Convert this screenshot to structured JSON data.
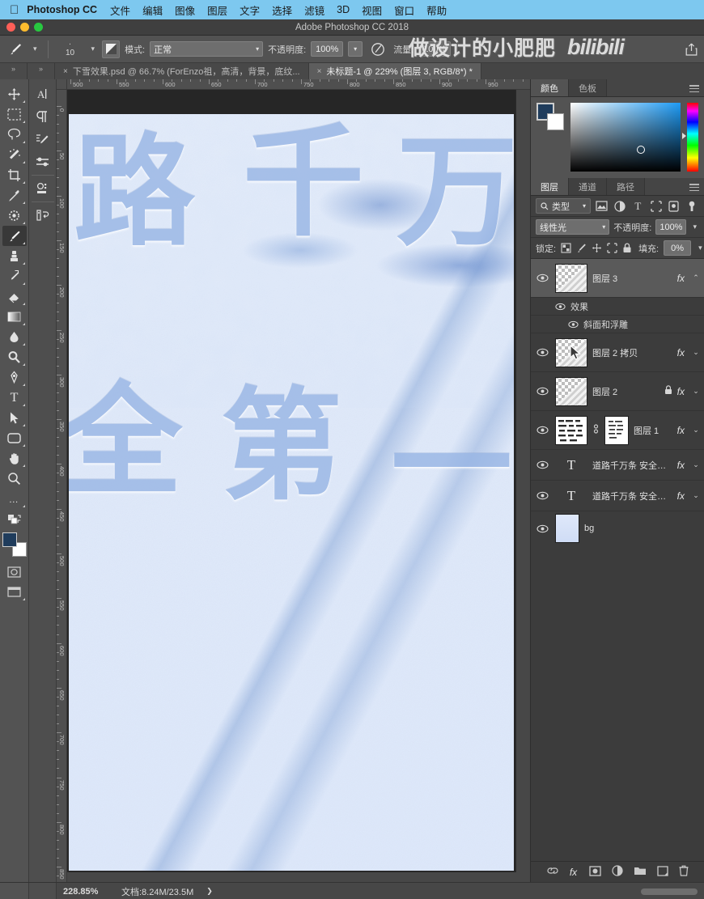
{
  "macmenu": {
    "apple_icon": "apple-icon",
    "app_name": "Photoshop CC",
    "items": [
      "文件",
      "编辑",
      "图像",
      "图层",
      "文字",
      "选择",
      "滤镜",
      "3D",
      "视图",
      "窗口",
      "帮助"
    ]
  },
  "titlebar": {
    "title": "Adobe Photoshop CC 2018"
  },
  "optionsbar": {
    "brush_preset_icon": "brush-icon",
    "brush_size": "10",
    "brush_size_dot": "·",
    "airbrush_icon": "airbrush-toggle-icon",
    "mode_label": "模式:",
    "mode_value": "正常",
    "opacity_label": "不透明度:",
    "opacity_value": "100%",
    "pressure_opacity_icon": "pressure-opacity-icon",
    "flow_label": "流量:",
    "flow_value": "100%",
    "share_icon": "share-icon",
    "watermark_cn": "做设计的小肥肥",
    "watermark_bili": "bilibili"
  },
  "tabs": [
    {
      "label": "下雪效果.psd @ 66.7% (ForEnzo祖，高清，背景，底纹...",
      "close": "×",
      "active": false
    },
    {
      "label": "未标题-1 @ 229% (图层 3, RGB/8*) *",
      "close": "×",
      "active": true
    }
  ],
  "toolbar": {
    "tools": [
      {
        "name": "move-tool",
        "glyph": "✥",
        "selected": false
      },
      {
        "name": "marquee-tool",
        "glyph": "▭",
        "selected": false
      },
      {
        "name": "lasso-tool",
        "glyph": "◯",
        "selected": false
      },
      {
        "name": "magic-wand-tool",
        "glyph": "✦",
        "selected": false
      },
      {
        "name": "crop-tool",
        "glyph": "⌗",
        "selected": false
      },
      {
        "name": "eyedropper-tool",
        "glyph": "⚲",
        "selected": false
      },
      {
        "name": "healing-brush-tool",
        "glyph": "✷",
        "selected": false
      },
      {
        "name": "brush-tool",
        "glyph": "🖌",
        "selected": true
      },
      {
        "name": "clone-stamp-tool",
        "glyph": "⬒",
        "selected": false
      },
      {
        "name": "history-brush-tool",
        "glyph": "❧",
        "selected": false
      },
      {
        "name": "eraser-tool",
        "glyph": "◣",
        "selected": false
      },
      {
        "name": "gradient-tool",
        "glyph": "▤",
        "selected": false
      },
      {
        "name": "blur-tool",
        "glyph": "💧",
        "selected": false
      },
      {
        "name": "dodge-tool",
        "glyph": "🔍",
        "selected": false
      },
      {
        "name": "pen-tool",
        "glyph": "✎",
        "selected": false
      },
      {
        "name": "type-tool",
        "glyph": "T",
        "selected": false
      },
      {
        "name": "path-selection-tool",
        "glyph": "➤",
        "selected": false
      },
      {
        "name": "rectangle-tool",
        "glyph": "▢",
        "selected": false
      },
      {
        "name": "hand-tool",
        "glyph": "✋",
        "selected": false
      },
      {
        "name": "zoom-tool",
        "glyph": "🔍",
        "selected": false
      },
      {
        "name": "more-tools",
        "glyph": "⋯",
        "selected": false
      }
    ],
    "foreground_color": "#1f3c5c",
    "background_color": "#ffffff"
  },
  "toolbar2": {
    "items": [
      {
        "name": "character-panel-icon"
      },
      {
        "name": "paragraph-panel-icon"
      },
      {
        "name": "brush-settings-icon"
      },
      {
        "name": "adjustments-icon"
      },
      {
        "name": "properties-icon"
      },
      {
        "name": "history-icon"
      }
    ]
  },
  "rulers": {
    "horizontal_ticks": [
      "500",
      "550",
      "600",
      "650",
      "700",
      "750",
      "800",
      "850",
      "900",
      "950"
    ],
    "vertical_ticks": [
      "0",
      "50",
      "100",
      "150",
      "200",
      "250",
      "300",
      "350",
      "400",
      "450",
      "500",
      "550",
      "600",
      "650",
      "700",
      "750",
      "800",
      "850"
    ]
  },
  "canvas": {
    "characters": [
      "路",
      "千",
      "万",
      "全",
      "第",
      "一"
    ],
    "snow_color": "#e3ecfb",
    "text_color": "#96b4e4"
  },
  "color_panel": {
    "tabs": [
      {
        "label": "颜色",
        "active": true
      },
      {
        "label": "色板",
        "active": false
      }
    ],
    "foreground": "#1f3c5c",
    "background": "#ffffff"
  },
  "layers_panel": {
    "tabs": [
      {
        "label": "图层",
        "active": true
      },
      {
        "label": "通道",
        "active": false
      },
      {
        "label": "路径",
        "active": false
      }
    ],
    "filter_label": "类型",
    "filter_icons": [
      "pixel-filter-icon",
      "adjustment-filter-icon",
      "type-filter-icon",
      "shape-filter-icon",
      "smartobject-filter-icon"
    ],
    "blend_mode": "线性光",
    "opacity_label": "不透明度:",
    "opacity_value": "100%",
    "lock_label": "锁定:",
    "lock_icons": [
      "lock-transparency-icon",
      "lock-image-icon",
      "lock-position-icon",
      "lock-nesting-icon",
      "lock-all-icon"
    ],
    "fill_label": "填充:",
    "fill_value": "0%",
    "layers": [
      {
        "name": "图层 3",
        "thumb": "diagonal",
        "fx": "fx",
        "chevron": "⌃",
        "selected": true,
        "locked": false,
        "visible": true
      },
      {
        "name": "图层 2 拷贝",
        "thumb": "diagonal",
        "fx": "fx",
        "chevron": "⌄",
        "selected": false,
        "locked": false,
        "visible": true
      },
      {
        "name": "图层 2",
        "thumb": "diagonal",
        "fx": "fx",
        "chevron": "⌄",
        "selected": false,
        "locked": true,
        "visible": true
      },
      {
        "name": "图层 1",
        "thumb": "mask",
        "fx": "fx",
        "chevron": "⌄",
        "selected": false,
        "locked": false,
        "visible": true
      },
      {
        "name": "道路千万条 安全第一...",
        "thumb": "type",
        "fx": "fx",
        "chevron": "⌄",
        "selected": false,
        "locked": false,
        "visible": true
      },
      {
        "name": "道路千万条 安全第一...",
        "thumb": "type",
        "fx": "fx",
        "chevron": "⌄",
        "selected": false,
        "locked": false,
        "visible": true
      },
      {
        "name": "bg",
        "thumb": "bg",
        "fx": "",
        "chevron": "",
        "selected": false,
        "locked": false,
        "visible": true
      }
    ],
    "effects": {
      "group_label": "效果",
      "items": [
        "斜面和浮雕"
      ]
    },
    "footer_icons": [
      "link-layers-icon",
      "add-fx-icon",
      "add-mask-icon",
      "new-adjustment-icon",
      "new-group-icon",
      "new-layer-icon",
      "delete-layer-icon"
    ],
    "footer_fx_label": "fx"
  },
  "statusbar": {
    "zoom": "228.85%",
    "doc_info": "文档:8.24M/23.5M",
    "arrow": "❯"
  }
}
